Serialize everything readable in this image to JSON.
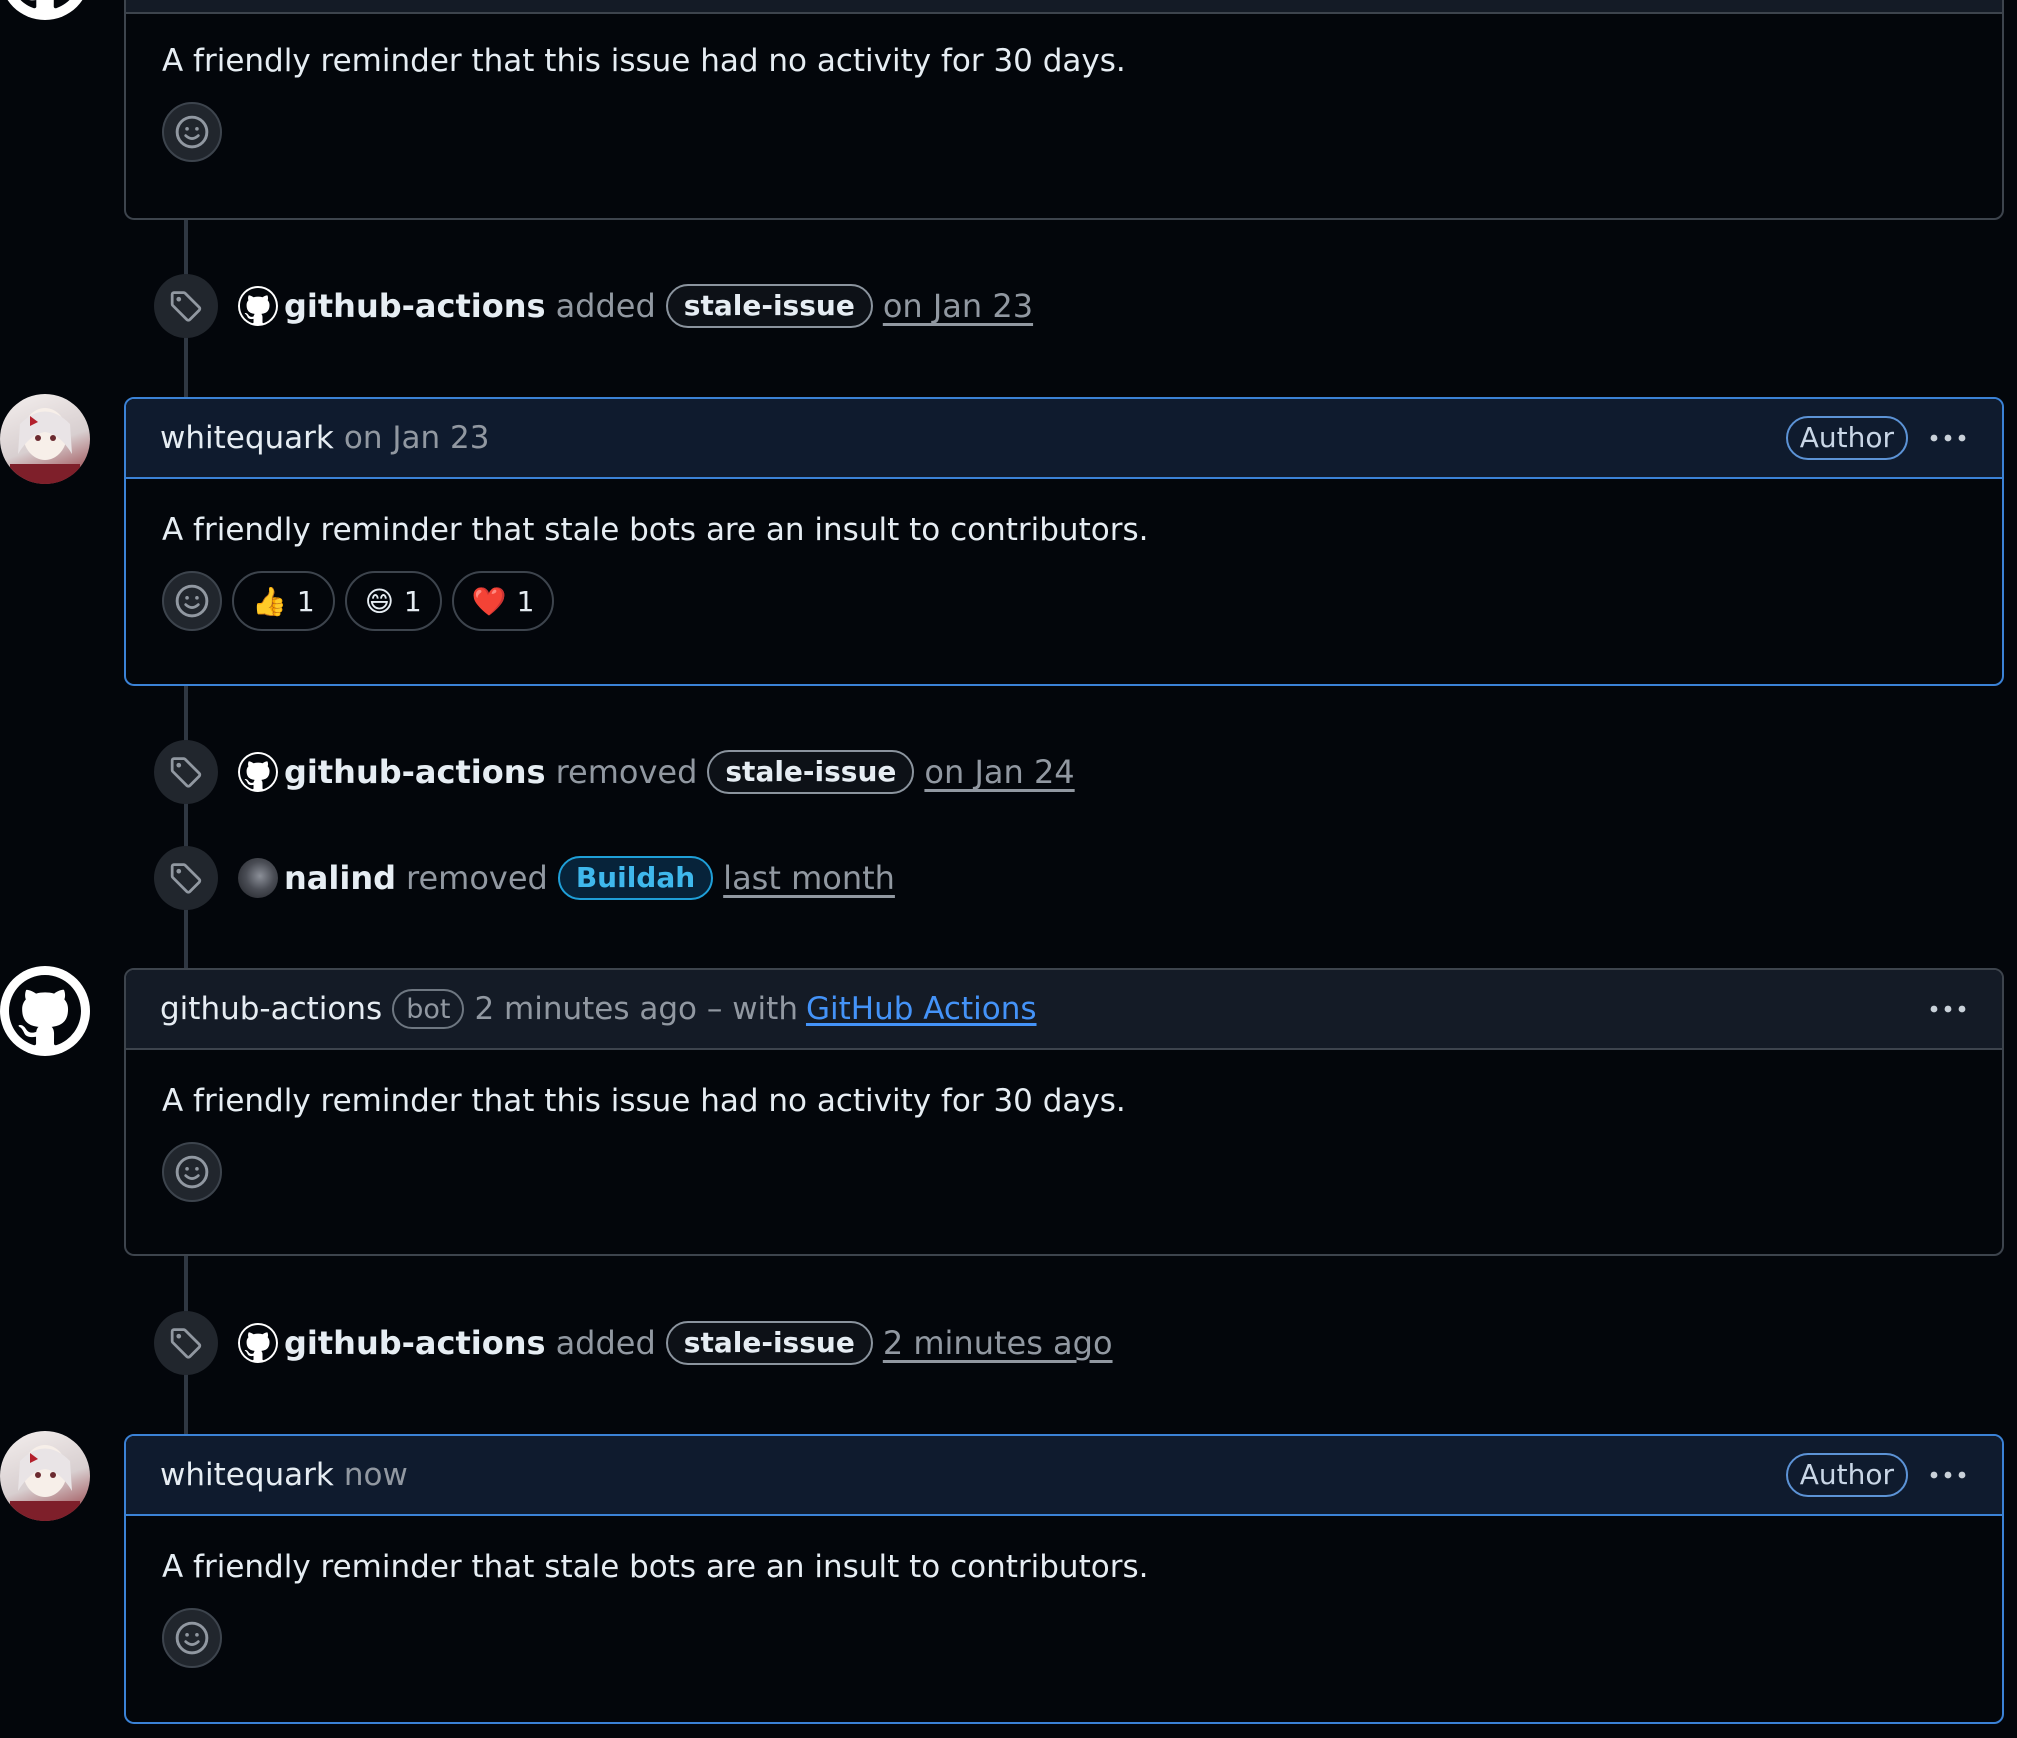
{
  "colors": {
    "background": "#03060b",
    "author_border": "#3b82d6",
    "link": "#4493f8",
    "buildah_label": "#1f9fd8"
  },
  "comment1": {
    "body": "A friendly reminder that this issue had no activity for 30 days."
  },
  "event1": {
    "actor": "github-actions",
    "verb": "added",
    "label": "stale-issue",
    "when": "on Jan 23"
  },
  "comment2": {
    "author": "whitequark",
    "when": "on Jan 23",
    "badge": "Author",
    "body": "A friendly reminder that stale bots are an insult to contributors.",
    "reactions": [
      {
        "emoji": "👍",
        "count": "1"
      },
      {
        "emoji": "😄",
        "count": "1"
      },
      {
        "emoji": "❤️",
        "count": "1"
      }
    ]
  },
  "event2": {
    "actor": "github-actions",
    "verb": "removed",
    "label": "stale-issue",
    "when": "on Jan 24"
  },
  "event3": {
    "actor": "nalind",
    "verb": "removed",
    "label": "Buildah",
    "when": "last month"
  },
  "comment3": {
    "author": "github-actions",
    "badge": "bot",
    "when": "2 minutes ago – with",
    "app_link": "GitHub Actions",
    "body": "A friendly reminder that this issue had no activity for 30 days."
  },
  "event4": {
    "actor": "github-actions",
    "verb": "added",
    "label": "stale-issue",
    "when": "2 minutes ago"
  },
  "comment4": {
    "author": "whitequark",
    "when": "now",
    "badge": "Author",
    "body": "A friendly reminder that stale bots are an insult to contributors."
  },
  "icons": {
    "github": "github-logo-icon",
    "tag": "tag-icon",
    "smiley": "smiley-icon",
    "kebab": "kebab-horizontal-icon"
  }
}
